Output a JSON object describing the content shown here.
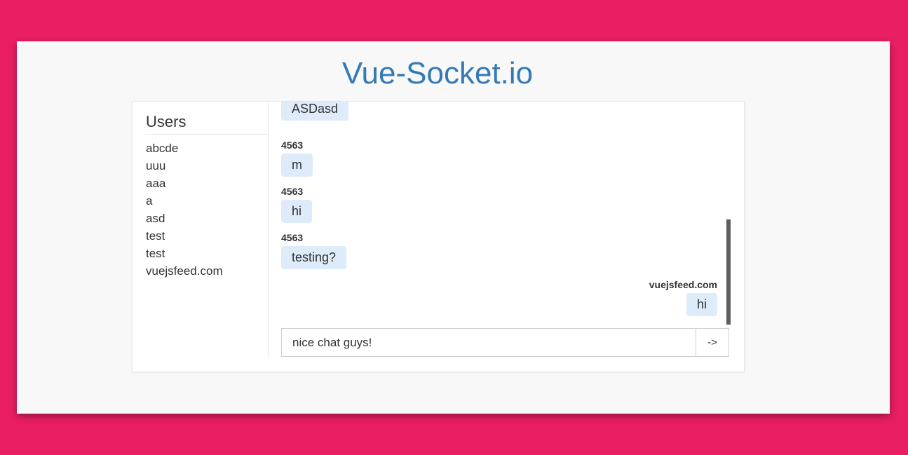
{
  "app": {
    "title": "Vue-Socket.io"
  },
  "users": {
    "heading": "Users",
    "items": [
      "abcde",
      "uuu",
      "aaa",
      "a",
      "asd",
      "test",
      "test",
      "vuejsfeed.com"
    ]
  },
  "messages": [
    {
      "author": "",
      "text": "ASDasd",
      "align": "left"
    },
    {
      "author": "4563",
      "text": "m",
      "align": "left"
    },
    {
      "author": "4563",
      "text": "hi",
      "align": "left"
    },
    {
      "author": "4563",
      "text": "testing?",
      "align": "left"
    },
    {
      "author": "vuejsfeed.com",
      "text": "hi",
      "align": "right"
    }
  ],
  "composer": {
    "value": "nice chat guys!",
    "send_label": "->"
  },
  "colors": {
    "background": "#e91e63",
    "title": "#337ab7",
    "bubble": "#ddebfa"
  }
}
